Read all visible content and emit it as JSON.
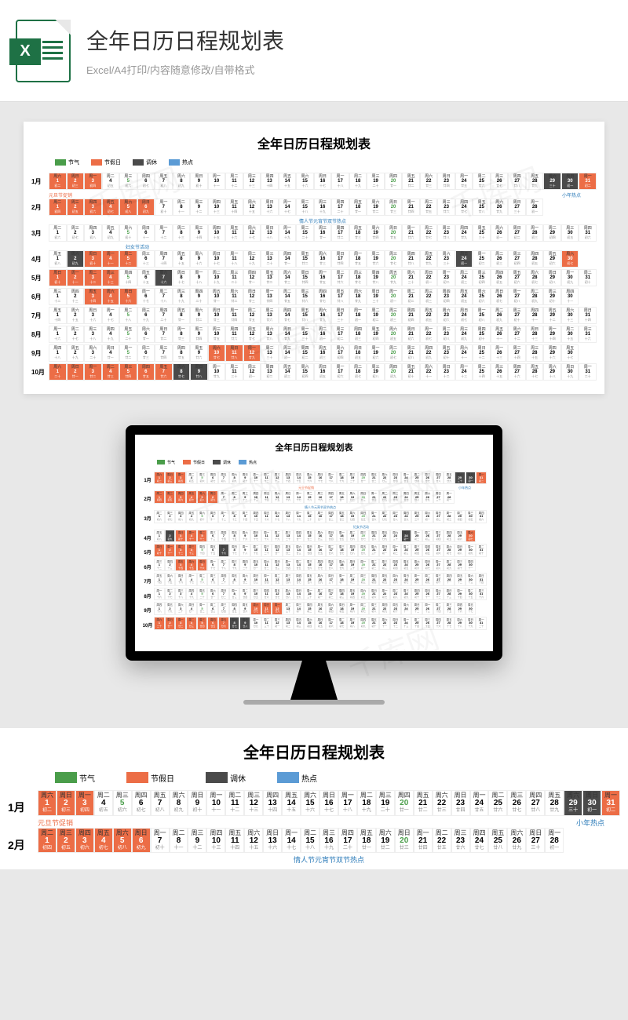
{
  "header": {
    "title": "全年日历日程规划表",
    "subtitle": "Excel/A4打印/内容随意修改/自带格式"
  },
  "sheet": {
    "title": "全年日历日程规划表",
    "legend": {
      "solar_term": "节气",
      "holiday": "节假日",
      "makeup": "调休",
      "hotspot": "热点"
    },
    "weekdays": [
      "周六",
      "周日",
      "周一",
      "周二",
      "周三",
      "周四",
      "周五"
    ],
    "months": [
      "1月",
      "2月",
      "3月",
      "4月",
      "5月",
      "6月",
      "7月",
      "8月",
      "9月",
      "10月"
    ],
    "promos": {
      "jan_left": "元旦节促销",
      "jan_right": "小年热点",
      "feb": "情人节元宵节双节热点",
      "mar": "妇女节活动"
    },
    "watermark": "千库网"
  },
  "chart_data": {
    "type": "table",
    "description": "Full-year calendar schedule planner, 10 month rows (Jan–Oct), 31 day columns each. Color codes: green=solar term, orange=public holiday, dark gray=work makeup day, blue=marketing hotspot.",
    "legend_colors": {
      "节气": "#4a9d4a",
      "节假日": "#ec6d46",
      "调休": "#4a4a4a",
      "热点": "#5b9bd5"
    },
    "highlights": {
      "1月": {
        "orange": [
          1,
          2,
          3
        ],
        "dark": [
          29,
          30
        ],
        "orange_end": [
          31
        ],
        "promo": "元旦节促销 / 小年热点"
      },
      "2月": {
        "orange": [
          1,
          2,
          3,
          4,
          5,
          6
        ],
        "promo": "情人节元宵节双节热点"
      },
      "3月": {
        "promo": "妇女节活动"
      },
      "4月": {
        "dark": [
          2
        ],
        "orange": [
          3,
          4,
          5
        ],
        "dark2": [
          24
        ],
        "orange_end": [
          30
        ]
      },
      "5月": {
        "orange": [
          1,
          2,
          3,
          4
        ],
        "dark": [
          7
        ]
      },
      "6月": {
        "orange": [
          3,
          4,
          5
        ]
      },
      "7月": {},
      "8月": {},
      "9月": {
        "orange": [
          10,
          11,
          12
        ]
      },
      "10月": {
        "orange": [
          1,
          2,
          3,
          4,
          5,
          6,
          7
        ],
        "dark": [
          8,
          9
        ]
      }
    }
  }
}
